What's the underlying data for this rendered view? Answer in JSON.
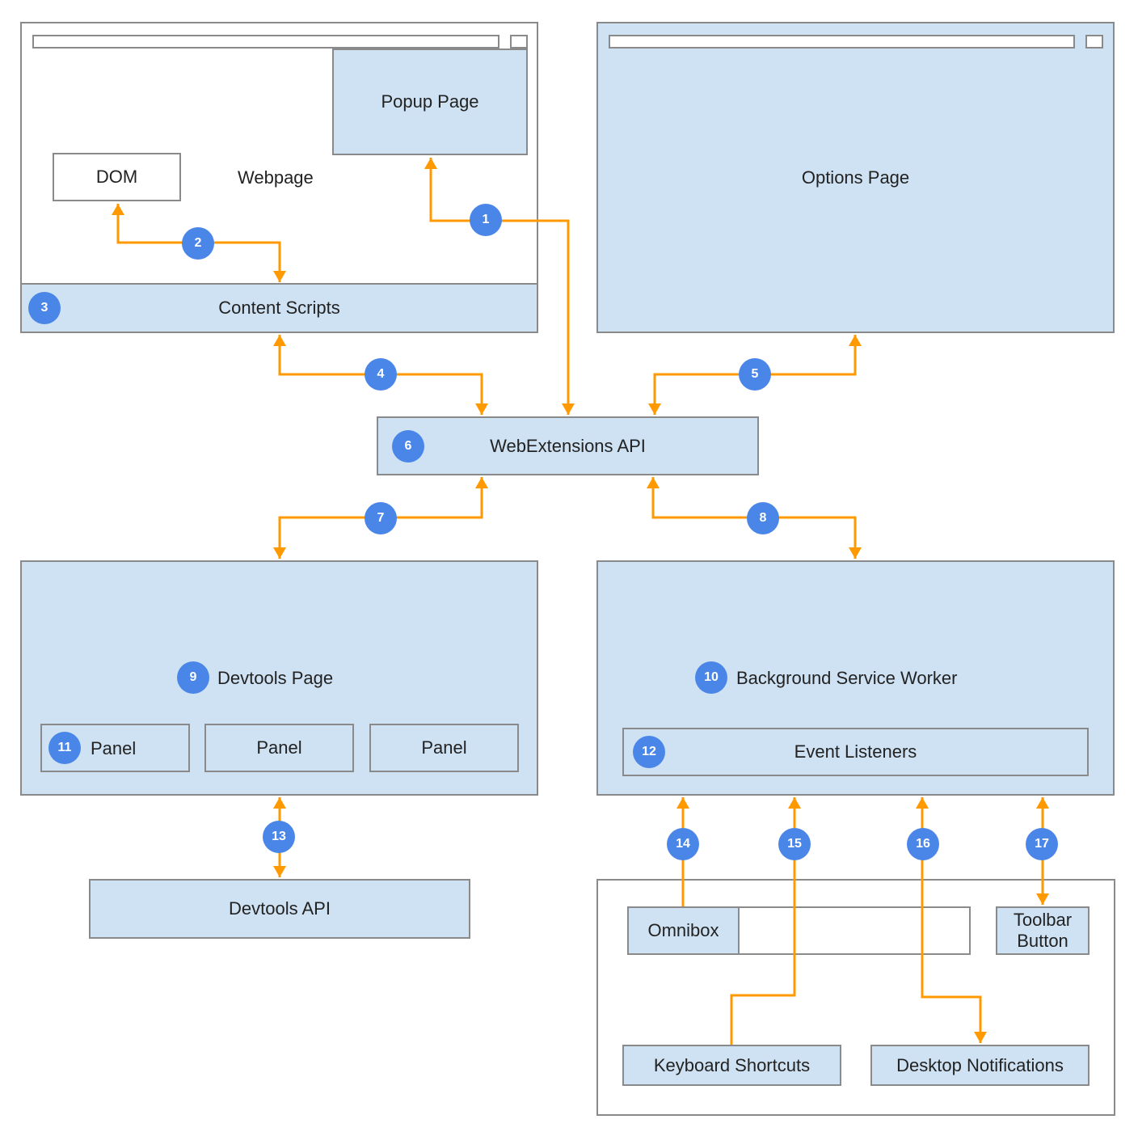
{
  "colors": {
    "box_fill": "#cfe2f3",
    "box_border": "#8a8a8a",
    "connector": "#ff9900",
    "badge": "#4a86e8"
  },
  "webpage": {
    "label": "Webpage",
    "dom_label": "DOM",
    "popup_label": "Popup Page",
    "content_scripts_label": "Content Scripts",
    "content_scripts_badge": "3"
  },
  "options": {
    "label": "Options Page"
  },
  "webext_api": {
    "label": "WebExtensions API",
    "badge": "6"
  },
  "devtools_page": {
    "label": "Devtools Page",
    "badge": "9",
    "panels": [
      {
        "label": "Panel",
        "badge": "11"
      },
      {
        "label": "Panel"
      },
      {
        "label": "Panel"
      }
    ]
  },
  "devtools_api": {
    "label": "Devtools API"
  },
  "background": {
    "label": "Background Service Worker",
    "badge": "10",
    "event_listeners_label": "Event Listeners",
    "event_listeners_badge": "12"
  },
  "browser_ui": {
    "omnibox_label": "Omnibox",
    "toolbar_button_label": "Toolbar Button",
    "toolbar_button_line1": "Toolbar",
    "toolbar_button_line2": "Button",
    "keyboard_shortcuts_label": "Keyboard Shortcuts",
    "desktop_notifications_label": "Desktop Notifications"
  },
  "connectors": [
    {
      "badge": "1",
      "from": "WebExtensions API",
      "to": "Popup Page"
    },
    {
      "badge": "2",
      "from": "Content Scripts",
      "to": "DOM"
    },
    {
      "badge": "4",
      "from": "Content Scripts",
      "to": "WebExtensions API"
    },
    {
      "badge": "5",
      "from": "Options Page",
      "to": "WebExtensions API"
    },
    {
      "badge": "7",
      "from": "WebExtensions API",
      "to": "Devtools Page"
    },
    {
      "badge": "8",
      "from": "WebExtensions API",
      "to": "Background Service Worker"
    },
    {
      "badge": "13",
      "from": "Devtools Page",
      "to": "Devtools API"
    },
    {
      "badge": "14",
      "from": "Omnibox",
      "to": "Background Service Worker"
    },
    {
      "badge": "15",
      "from": "Keyboard Shortcuts",
      "to": "Background Service Worker"
    },
    {
      "badge": "16",
      "from": "Background Service Worker",
      "to": "Desktop Notifications"
    },
    {
      "badge": "17",
      "from": "Background Service Worker",
      "to": "Toolbar Button"
    }
  ]
}
